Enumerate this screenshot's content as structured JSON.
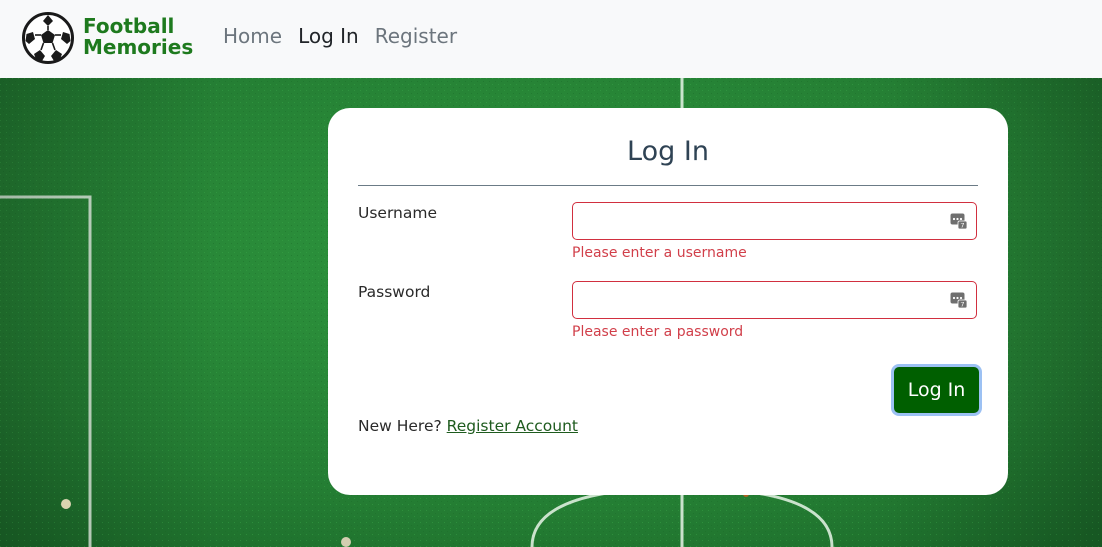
{
  "navbar": {
    "brand_line1": "Football",
    "brand_line2": "Memories",
    "links": [
      {
        "label": "Home",
        "active": false
      },
      {
        "label": "Log In",
        "active": true
      },
      {
        "label": "Register",
        "active": false
      }
    ]
  },
  "card": {
    "title": "Log In",
    "username_label": "Username",
    "username_value": "",
    "username_error": "Please enter a username",
    "password_label": "Password",
    "password_value": "",
    "password_error": "Please enter a password",
    "submit_label": "Log In",
    "footer_prefix": "New Here?",
    "footer_link": "Register Account"
  },
  "colors": {
    "brand_green": "#1e7a1e",
    "button_green": "#005f00",
    "error_red": "#d13f4a",
    "field_green": "#2a8a3a"
  },
  "icons": {
    "logo": "soccer-ball-icon",
    "password_manager": "password-manager-icon"
  }
}
